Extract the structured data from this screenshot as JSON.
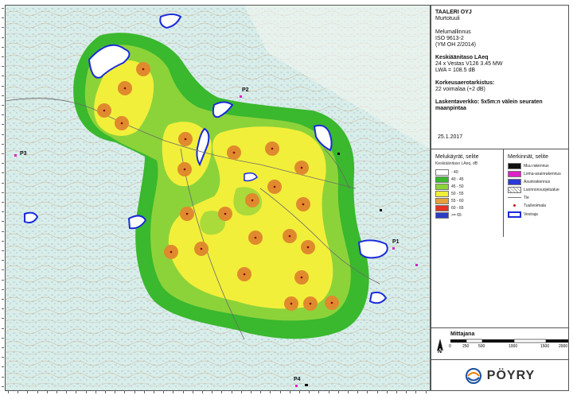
{
  "panel": {
    "company": "TAALERI OYJ",
    "project": "Murtotuuli",
    "model_title": "Melumallinnus",
    "standard": "ISO 9613-2",
    "standard_note": "(YM OH 2/2014)",
    "level_title": "Keskiäänitaso LAeq",
    "turbines": "24 x Vestas V126 3.45 MW",
    "lwa": "LWA = 108.5 dB",
    "correction_title": "Korkeusaerotarkistus:",
    "correction_value": "22 voimalaa (+2 dB)",
    "grid_line1": "Laskentaverkko: 5x5m:n välein seuraten",
    "grid_line2": "maanpintaa",
    "date": "25.1.2017"
  },
  "noise_legend": {
    "title": "Melukäyrät, selite",
    "subtitle": "Keskiäänitaso LAeq, dB",
    "items": [
      {
        "label": "- 40",
        "color": "#ffffff"
      },
      {
        "label": "40 - 45",
        "color": "#3ab82e"
      },
      {
        "label": "45 - 50",
        "color": "#8cd33a"
      },
      {
        "label": "50 - 55",
        "color": "#f2ef3a"
      },
      {
        "label": "55 - 60",
        "color": "#e8a13a"
      },
      {
        "label": "60 - 65",
        "color": "#e63225"
      },
      {
        "label": ">= 65",
        "color": "#2b3cc7"
      }
    ]
  },
  "symbol_legend": {
    "title": "Merkinnät, selite",
    "items": [
      {
        "label": "Muu rakennus",
        "color": "#111111"
      },
      {
        "label": "Loma-asuinrakennus",
        "color": "#e020c8"
      },
      {
        "label": "Asuinrakennus",
        "color": "#2a3ad8"
      },
      {
        "label": "Luonnonsuojelualue",
        "color": "#cccccc"
      },
      {
        "label": "Tie",
        "color": "#777777"
      },
      {
        "label": "Tuulivoimala",
        "color": "#cc1111"
      },
      {
        "label": "Vesiraja",
        "color": "#1a2bd8"
      }
    ]
  },
  "scale_bar": {
    "title": "Mittajana",
    "labels": [
      "0",
      "250",
      "500",
      "1000",
      "1500",
      "2000"
    ],
    "unit": "m",
    "north": "N"
  },
  "logo": {
    "name": "PÖYRY"
  },
  "points": [
    "P1",
    "P2",
    "P3",
    "P4"
  ],
  "turbines": [
    {
      "id": 1
    },
    {
      "id": 2
    },
    {
      "id": 3
    },
    {
      "id": 4
    },
    {
      "id": 5
    },
    {
      "id": 6
    },
    {
      "id": 7
    },
    {
      "id": 8
    },
    {
      "id": 9
    },
    {
      "id": 10
    },
    {
      "id": 11
    },
    {
      "id": 12
    },
    {
      "id": 13
    },
    {
      "id": 14
    },
    {
      "id": 15
    },
    {
      "id": 16
    },
    {
      "id": 17
    },
    {
      "id": 18
    },
    {
      "id": 19
    },
    {
      "id": 20
    },
    {
      "id": 21
    },
    {
      "id": 22
    },
    {
      "id": 23
    },
    {
      "id": 24
    }
  ]
}
